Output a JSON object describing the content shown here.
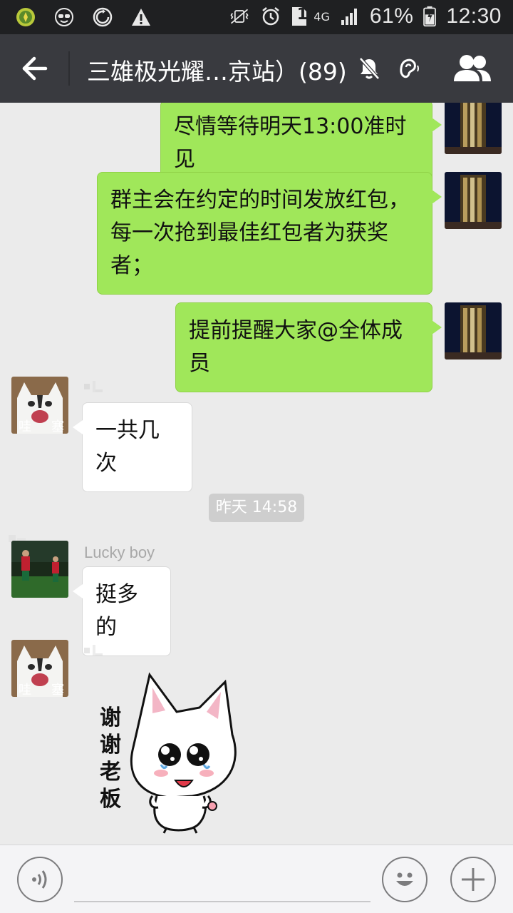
{
  "status_bar": {
    "battery": "61%",
    "time": "12:30",
    "sim": "1",
    "network": "4G",
    "icons": [
      "app-coin-icon",
      "sunglasses-face-icon",
      "sync-icon",
      "warning-icon",
      "vibrate-icon",
      "alarm-icon",
      "sim-icon",
      "signal-icon",
      "battery-icon"
    ]
  },
  "titlebar": {
    "title": "三雄极光耀…京站）(89)",
    "icons": [
      "back-arrow-icon",
      "mute-icon",
      "earpiece-icon",
      "group-members-icon"
    ]
  },
  "messages": [
    {
      "side": "me",
      "text": "尽情等待明天13:00准时见"
    },
    {
      "side": "me",
      "text": "群主会在约定的时间发放红包，每一次抢到最佳红包者为获奖者；"
    },
    {
      "side": "me",
      "text": "提前提醒大家@全体成员"
    },
    {
      "side": "other",
      "text": "一共几次"
    },
    {
      "side": "other",
      "sender": "Lucky boy",
      "text": "挺多的"
    },
    {
      "side": "other",
      "sticker": "cat-sticker"
    }
  ],
  "avatar_overlay": {
    "left": "哇",
    "right": "塞"
  },
  "timestamp": "昨天 14:58",
  "sticker_text": "谢谢老板",
  "inputbar": {
    "icons": [
      "voice-icon",
      "emoji-icon",
      "plus-icon"
    ]
  },
  "colors": {
    "titlebar_bg": "#393a3f",
    "statusbar_bg": "#1f2022",
    "chat_bg": "#ebebeb",
    "my_bubble": "#a0e75a",
    "other_bubble": "#ffffff"
  }
}
